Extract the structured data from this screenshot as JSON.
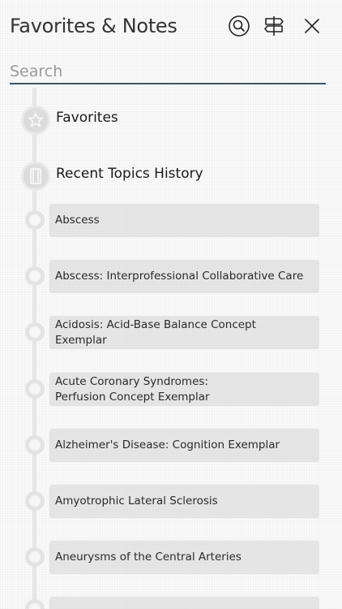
{
  "header": {
    "title": "Favorites & Notes",
    "icons": {
      "search": "search-icon",
      "signpost": "signpost-icon",
      "close": "close-icon"
    }
  },
  "search": {
    "placeholder": "Search",
    "value": ""
  },
  "sections": {
    "favorites": {
      "label": "Favorites",
      "icon": "star-icon"
    },
    "recent": {
      "label": "Recent Topics History",
      "icon": "book-icon"
    }
  },
  "topics": [
    "Abscess",
    "Abscess: Interprofessional Collaborative Care",
    "Acidosis: Acid-Base Balance Concept Exemplar",
    "Acute Coronary Syndromes: Perfusion Concept Exemplar",
    "Alzheimer's Disease: Cognition Exemplar",
    "Amyotrophic Lateral Sclerosis",
    "Aneurysms of the Central Arteries"
  ],
  "colors": {
    "search_underline": "#3e5760",
    "timeline": "#e6e6e6",
    "card": "#e9e9e9"
  }
}
